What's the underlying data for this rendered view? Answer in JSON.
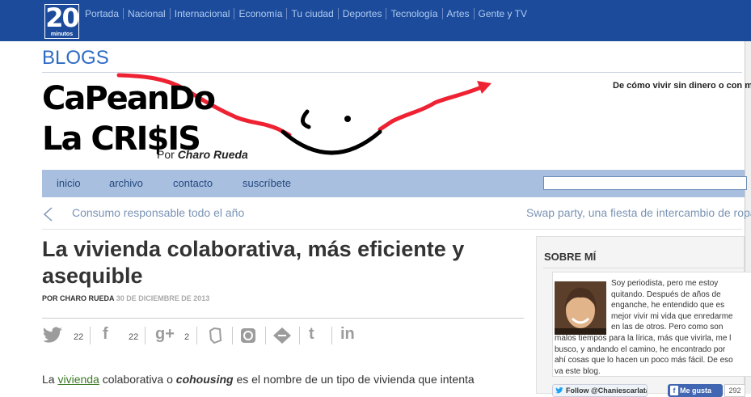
{
  "topbar": {
    "logo_number": "20",
    "logo_sub": "minutos",
    "nav": [
      "Portada",
      "Nacional",
      "Internacional",
      "Economía",
      "Tu ciudad",
      "Deportes",
      "Tecnología",
      "Artes",
      "Gente y TV"
    ]
  },
  "blogs_label": "BLOGS",
  "brand": {
    "line1": "CaPeanDo",
    "line2": "La CRI$IS",
    "byline_prefix": "Por",
    "byline_author": "Charo Rueda"
  },
  "tagline": "De cómo vivir sin dinero o con mu",
  "menu": [
    "inicio",
    "archivo",
    "contacto",
    "suscríbete"
  ],
  "post_nav": {
    "prev": "Consumo responsable todo el año",
    "next": "Swap party, una fiesta de intercambio de ropa"
  },
  "article": {
    "title": "La vivienda colaborativa, más eficiente y asequible",
    "author": "POR CHARO RUEDA",
    "date": "30 DE DICIEMBRE DE 2013",
    "share": {
      "twitter": "22",
      "facebook": "22",
      "googleplus": "2"
    },
    "body_start": "La",
    "body_link": "vivienda",
    "body_mid": " colaborativa o ",
    "body_em": "cohousing",
    "body_end": "  es el nombre de un tipo de vivienda que intenta"
  },
  "sidebar": {
    "heading": "SOBRE MÍ",
    "about_lines": [
      "Soy periodista, pero me estoy",
      "quitando. Después de años de",
      "enganche, he entendido que es",
      "mejor vivir mi vida que enredarme",
      "en las de otros. Pero como son",
      "malos tiempos para la lírica, más que vivirla, me l",
      "busco, y andando el camino, he encontrado por",
      "ahí cosas que lo hacen un poco más fácil. De eso",
      "va este blog."
    ],
    "follow": "Follow @Chaniescarlata",
    "like": "Me gusta",
    "like_count": "292"
  },
  "colors": {
    "topbar": "#1c4b9c",
    "menubar": "#a8bfdf",
    "accent_red": "#ee2233"
  },
  "icons": [
    "twitter-icon",
    "facebook-icon",
    "googleplus-icon",
    "evernote-icon",
    "meneame-icon",
    "delicious-icon",
    "tumblr-icon",
    "linkedin-icon",
    "chevron-left-icon"
  ]
}
